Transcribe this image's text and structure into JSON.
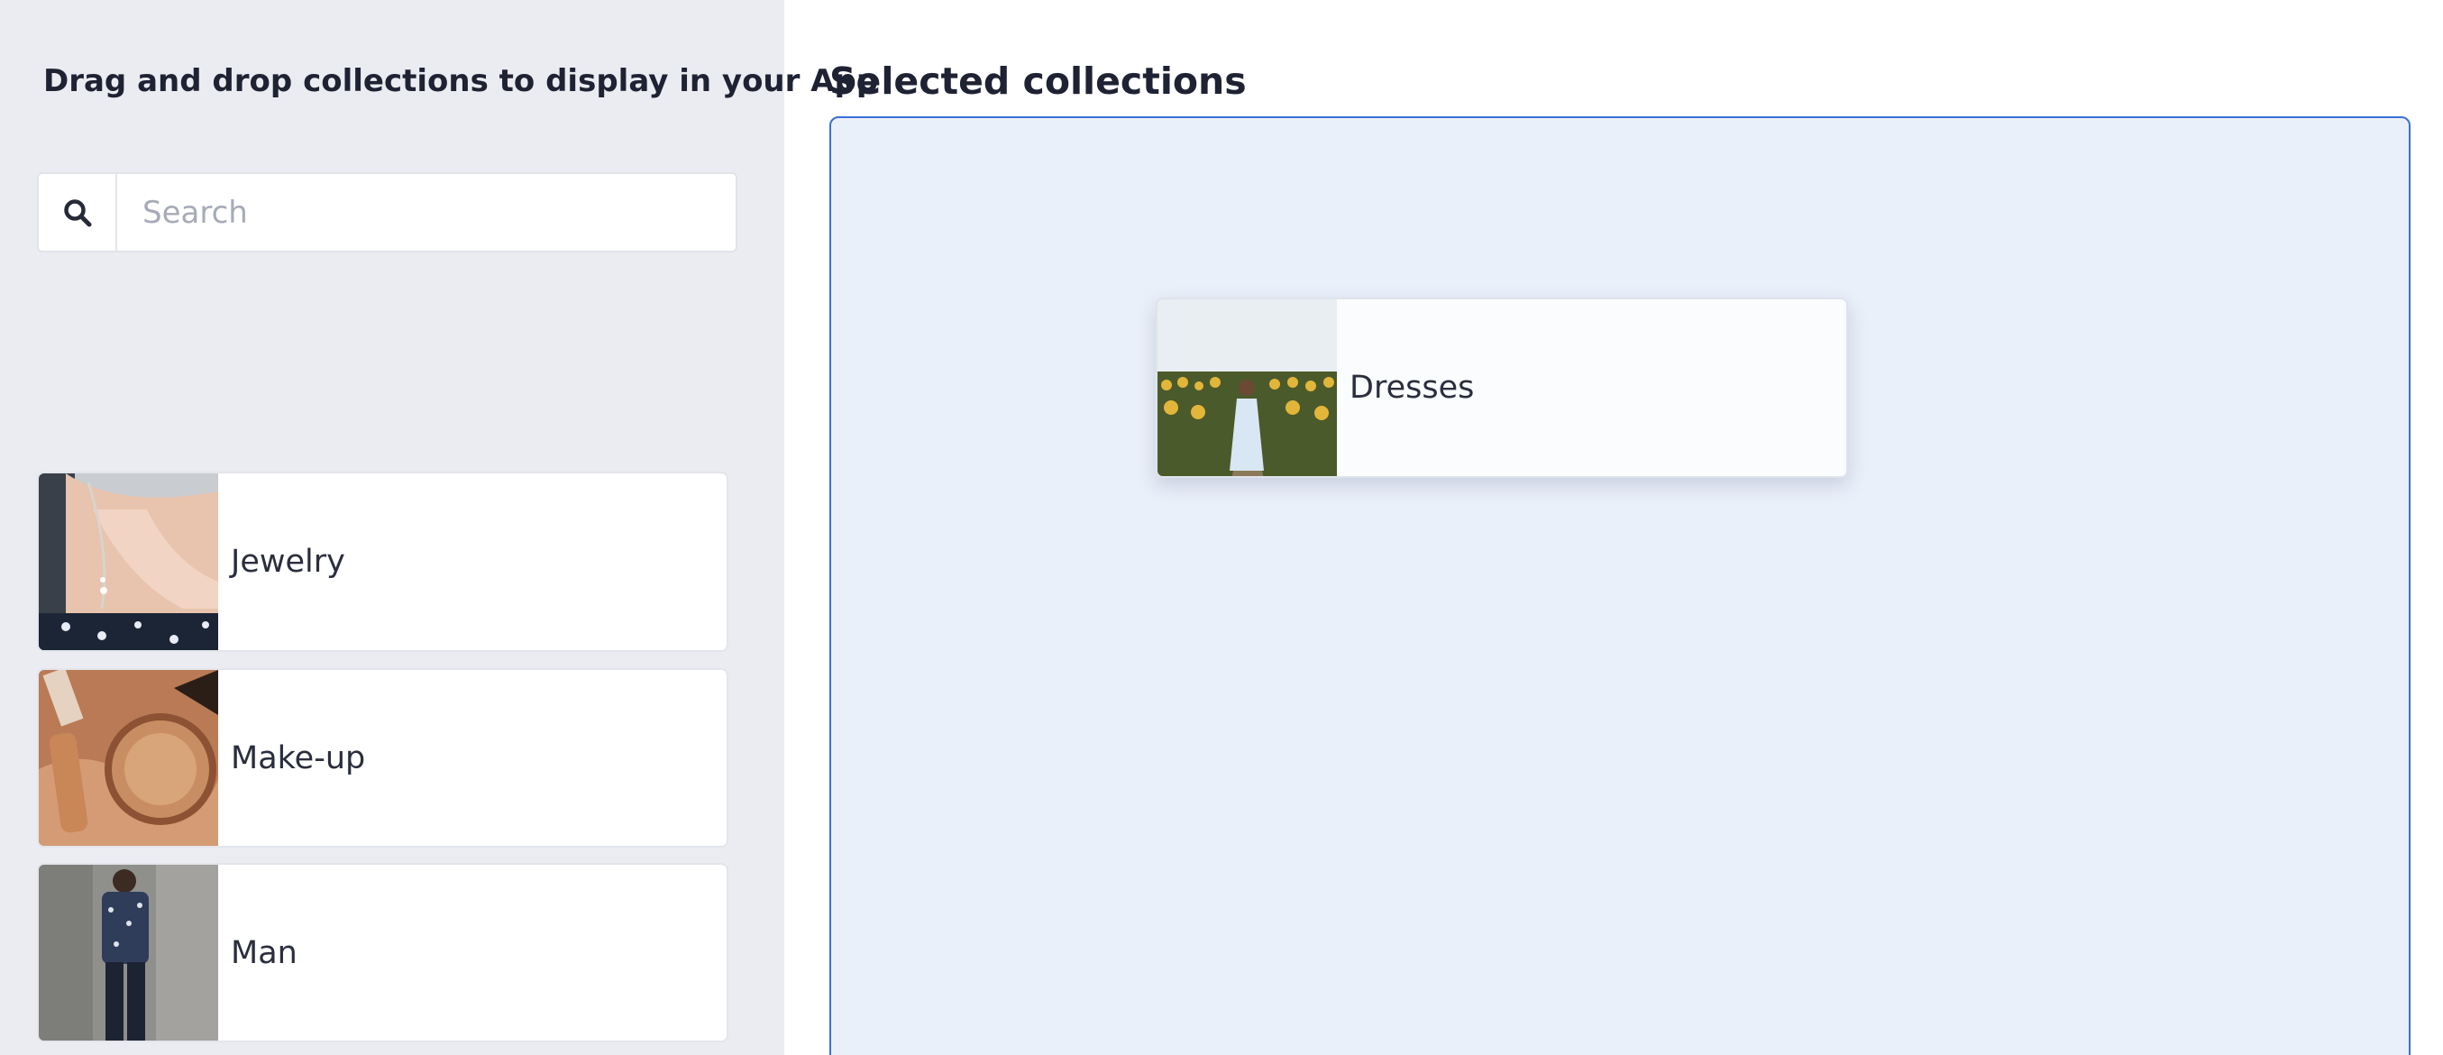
{
  "left_panel": {
    "title": "Drag and drop collections to display in your App",
    "search": {
      "placeholder": "Search",
      "value": "",
      "icon": "search-icon"
    },
    "collections": [
      {
        "label": "Jewelry"
      },
      {
        "label": "Make-up"
      },
      {
        "label": "Man"
      }
    ]
  },
  "right_panel": {
    "title": "Selected collections",
    "dragging_item": {
      "label": "Dresses"
    }
  },
  "colors": {
    "left_background": "#ebecf1",
    "drop_zone_background": "#eaf0fa",
    "drop_zone_border": "#3a6fd8",
    "text_primary": "#1e2233"
  }
}
